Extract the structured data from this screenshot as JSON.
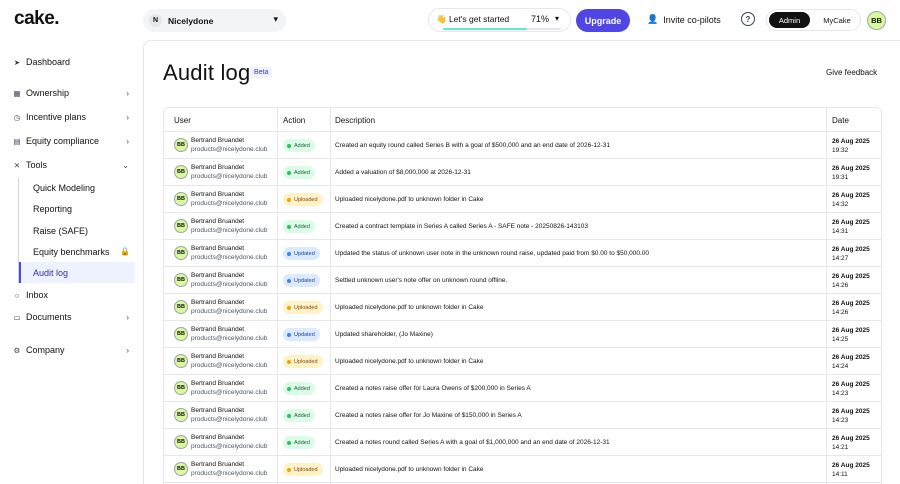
{
  "header": {
    "logo": "cake.",
    "company": {
      "initial": "N",
      "name": "Nicelydone"
    },
    "progress": {
      "label": "👋 Let's get started",
      "percent": "71%",
      "fill": 71
    },
    "upgrade_label": "Upgrade",
    "invite_label": "Invite co-pilots",
    "help_label": "?",
    "mode": {
      "admin": "Admin",
      "mycake": "MyCake"
    },
    "avatar_initials": "BB"
  },
  "sidebar": {
    "items": [
      {
        "label": "Dashboard"
      },
      {
        "label": "Ownership"
      },
      {
        "label": "Incentive plans"
      },
      {
        "label": "Equity compliance"
      },
      {
        "label": "Tools"
      },
      {
        "label": "Inbox"
      },
      {
        "label": "Documents"
      },
      {
        "label": "Company"
      }
    ],
    "tools_sub": [
      {
        "label": "Quick Modeling"
      },
      {
        "label": "Reporting"
      },
      {
        "label": "Raise (SAFE)"
      },
      {
        "label": "Equity benchmarks"
      },
      {
        "label": "Audit log"
      }
    ]
  },
  "main": {
    "title": "Audit log",
    "beta": "Beta",
    "feedback": "Give feedback",
    "columns": {
      "user": "User",
      "action": "Action",
      "description": "Description",
      "date": "Date"
    }
  },
  "rows": [
    {
      "initials": "BB",
      "name": "Bertrand Bruandet",
      "email": "products@nicelydone.club",
      "action": "Added",
      "description": "Created an equity round called Series B with a goal of $500,000 and an end date of 2026-12-31",
      "date": "26 Aug 2025",
      "time": "19:32"
    },
    {
      "initials": "BB",
      "name": "Bertrand Bruandet",
      "email": "products@nicelydone.club",
      "action": "Added",
      "description": "Added a valuation of $8,000,000 at 2026-12-31",
      "date": "26 Aug 2025",
      "time": "19:31"
    },
    {
      "initials": "BB",
      "name": "Bertrand Bruandet",
      "email": "products@nicelydone.club",
      "action": "Uploaded",
      "description": "Uploaded nicelydone.pdf to unknown folder in Cake",
      "date": "26 Aug 2025",
      "time": "14:32"
    },
    {
      "initials": "BB",
      "name": "Bertrand Bruandet",
      "email": "products@nicelydone.club",
      "action": "Added",
      "description": "Created a contract template in Series A called Series A - SAFE note - 20250826-143103",
      "date": "26 Aug 2025",
      "time": "14:31"
    },
    {
      "initials": "BB",
      "name": "Bertrand Bruandet",
      "email": "products@nicelydone.club",
      "action": "Updated",
      "description": "Updated the status of unknown user note in the unknown round raise, updated paid from $0.00 to $50,000.00",
      "date": "26 Aug 2025",
      "time": "14:27"
    },
    {
      "initials": "BB",
      "name": "Bertrand Bruandet",
      "email": "products@nicelydone.club",
      "action": "Updated",
      "description": "Settled unknown user's note offer on unknown round offline.",
      "date": "26 Aug 2025",
      "time": "14:26"
    },
    {
      "initials": "BB",
      "name": "Bertrand Bruandet",
      "email": "products@nicelydone.club",
      "action": "Uploaded",
      "description": "Uploaded nicelydone.pdf to unknown folder in Cake",
      "date": "26 Aug 2025",
      "time": "14:26"
    },
    {
      "initials": "BB",
      "name": "Bertrand Bruandet",
      "email": "products@nicelydone.club",
      "action": "Updated",
      "description": "Updated shareholder, (Jo Maxine)",
      "date": "26 Aug 2025",
      "time": "14:25"
    },
    {
      "initials": "BB",
      "name": "Bertrand Bruandet",
      "email": "products@nicelydone.club",
      "action": "Uploaded",
      "description": "Uploaded nicelydone.pdf to unknown folder in Cake",
      "date": "26 Aug 2025",
      "time": "14:24"
    },
    {
      "initials": "BB",
      "name": "Bertrand Bruandet",
      "email": "products@nicelydone.club",
      "action": "Added",
      "description": "Created a notes raise offer for Laura Owens of $200,000 in Series A",
      "date": "26 Aug 2025",
      "time": "14:23"
    },
    {
      "initials": "BB",
      "name": "Bertrand Bruandet",
      "email": "products@nicelydone.club",
      "action": "Added",
      "description": "Created a notes raise offer for Jo Maxine of $150,000 in Series A",
      "date": "26 Aug 2025",
      "time": "14:23"
    },
    {
      "initials": "BB",
      "name": "Bertrand Bruandet",
      "email": "products@nicelydone.club",
      "action": "Added",
      "description": "Created a notes round called Series A with a goal of $1,000,000 and an end date of 2026-12-31",
      "date": "26 Aug 2025",
      "time": "14:21"
    },
    {
      "initials": "BB",
      "name": "Bertrand Bruandet",
      "email": "products@nicelydone.club",
      "action": "Uploaded",
      "description": "Uploaded nicelydone.pdf to unknown folder in Cake",
      "date": "26 Aug 2025",
      "time": "14:11"
    }
  ],
  "colors": {
    "accent": "#4f46e5",
    "added_bg": "#dcfce7",
    "added_text": "#166534",
    "added_dot": "#22c55e",
    "updated_bg": "#dbeafe",
    "updated_text": "#1e40af",
    "updated_dot": "#3b82f6",
    "uploaded_bg": "#fef3c7",
    "uploaded_text": "#92400e",
    "uploaded_dot": "#f59e0b"
  }
}
